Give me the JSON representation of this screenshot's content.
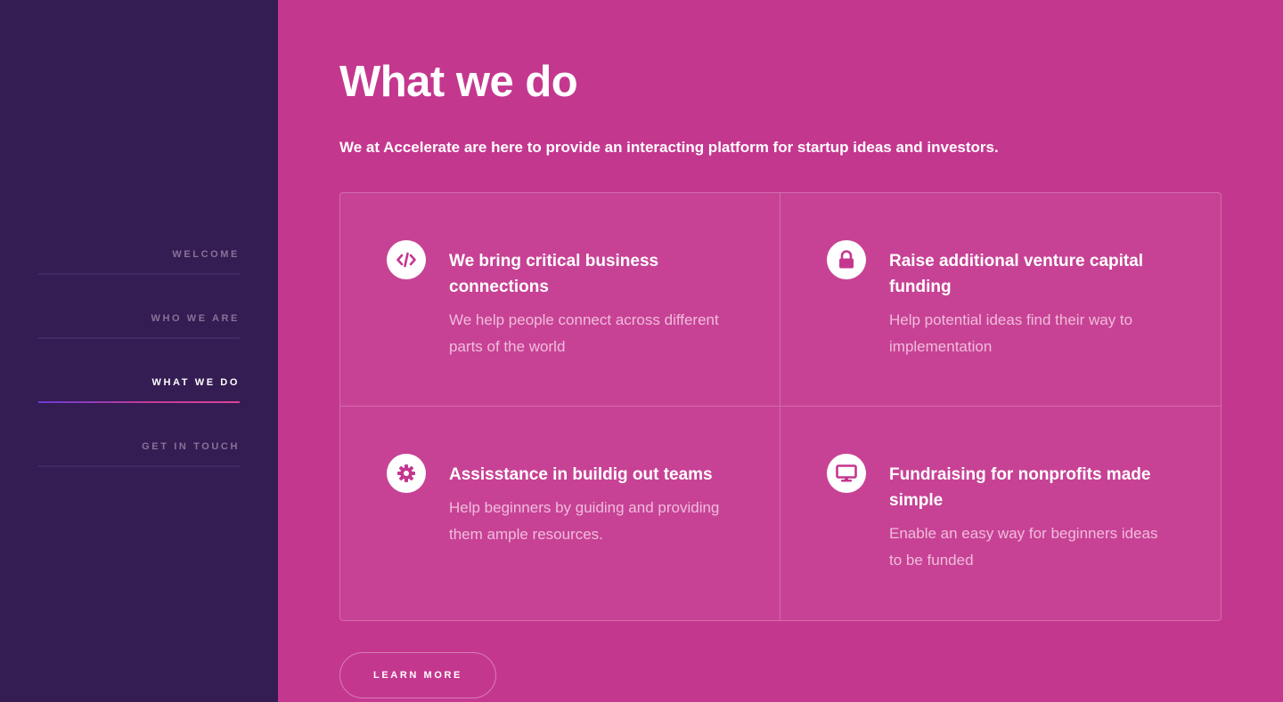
{
  "nav": {
    "items": [
      {
        "label": "WELCOME",
        "active": false
      },
      {
        "label": "WHO WE ARE",
        "active": false
      },
      {
        "label": "WHAT WE DO",
        "active": true
      },
      {
        "label": "GET IN TOUCH",
        "active": false
      }
    ]
  },
  "main": {
    "title": "What we do",
    "intro": "We at Accelerate are here to provide an interacting platform for startup ideas and investors.",
    "cards": [
      {
        "icon": "code-icon",
        "title": "We bring critical business connections",
        "description": "We help people connect across different parts of the world"
      },
      {
        "icon": "lock-icon",
        "title": "Raise additional venture capital funding",
        "description": "Help potential ideas find their way to implementation"
      },
      {
        "icon": "gear-icon",
        "title": "Assisstance in buildig out teams",
        "description": "Help beginners by guiding and providing them ample resources."
      },
      {
        "icon": "monitor-icon",
        "title": "Fundraising for nonprofits made simple",
        "description": "Enable an easy way for beginners ideas to be funded"
      }
    ],
    "learn_more_label": "LEARN MORE"
  },
  "colors": {
    "sidebar_bg": "#331d52",
    "main_bg": "#c4378f",
    "accent": "#c4378f"
  }
}
